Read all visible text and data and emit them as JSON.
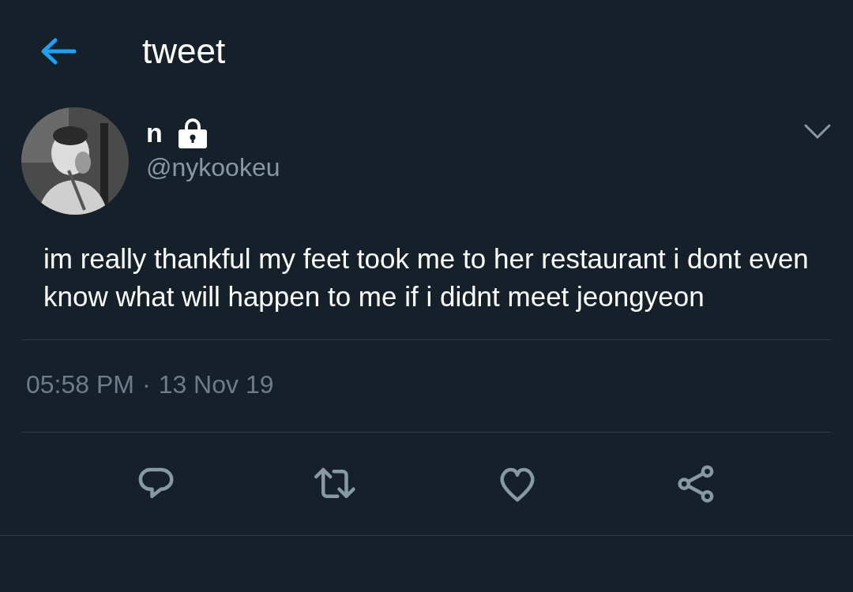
{
  "header": {
    "title": "tweet"
  },
  "tweet": {
    "author": {
      "name": "n",
      "protected": true,
      "handle": "@nykookeu"
    },
    "text": "im really thankful my feet took me to her restaurant i dont even know what will happen to me if i didnt meet jeongyeon",
    "time": "05:58 PM",
    "separator": "·",
    "date": "13 Nov 19"
  },
  "actions": [
    {
      "kind": "reply"
    },
    {
      "kind": "retweet"
    },
    {
      "kind": "like"
    },
    {
      "kind": "share"
    }
  ]
}
